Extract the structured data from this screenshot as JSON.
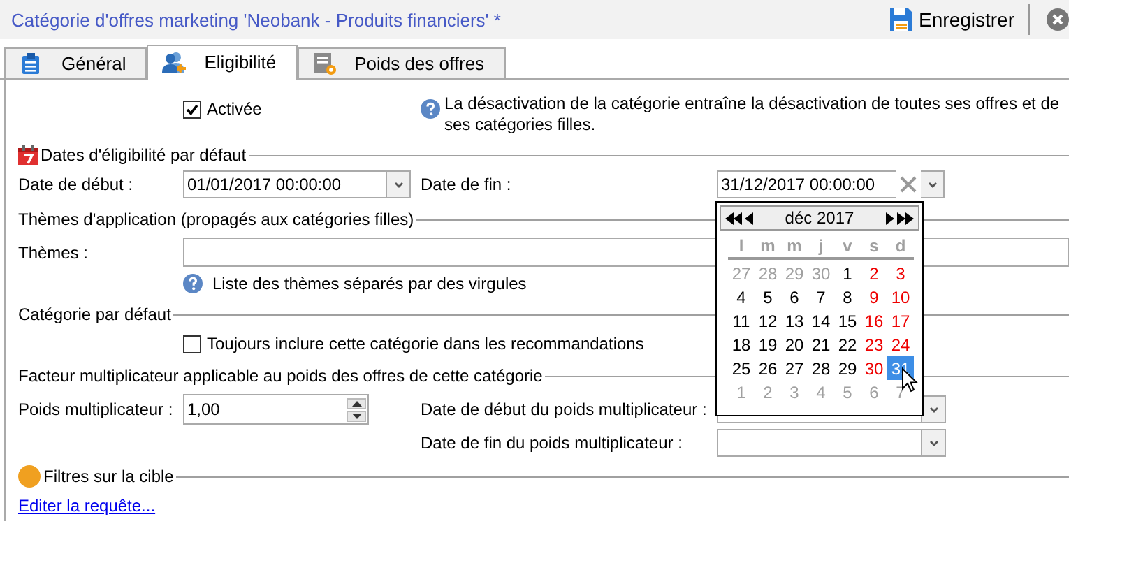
{
  "window": {
    "title": "Catégorie d'offres marketing 'Neobank - Produits financiers' *"
  },
  "toolbar": {
    "save_label": "Enregistrer"
  },
  "tabs": [
    {
      "label": "Général",
      "selected": false
    },
    {
      "label": "Eligibilité",
      "selected": true
    },
    {
      "label": "Poids des offres",
      "selected": false
    }
  ],
  "activation": {
    "label": "Activée",
    "checked": true,
    "help": "La désactivation de la catégorie entraîne la désactivation de toutes ses offres et de ses catégories filles."
  },
  "eligibility_dates": {
    "heading": "Dates d'éligibilité par défaut",
    "start": {
      "label": "Date de début :",
      "value": "01/01/2017 00:00:00"
    },
    "end": {
      "label": "Date de fin :",
      "value": "31/12/2017 00:00:00"
    }
  },
  "calendar": {
    "month": "déc 2017",
    "weekdays": [
      "l",
      "m",
      "m",
      "j",
      "v",
      "s",
      "d"
    ],
    "weeks": [
      [
        {
          "day": "27",
          "kind": "other",
          "selected": false
        },
        {
          "day": "28",
          "kind": "other",
          "selected": false
        },
        {
          "day": "29",
          "kind": "other",
          "selected": false
        },
        {
          "day": "30",
          "kind": "other",
          "selected": false
        },
        {
          "day": "1",
          "kind": "weekday",
          "selected": false
        },
        {
          "day": "2",
          "kind": "weekend",
          "selected": false
        },
        {
          "day": "3",
          "kind": "weekend",
          "selected": false
        }
      ],
      [
        {
          "day": "4",
          "kind": "weekday",
          "selected": false
        },
        {
          "day": "5",
          "kind": "weekday",
          "selected": false
        },
        {
          "day": "6",
          "kind": "weekday",
          "selected": false
        },
        {
          "day": "7",
          "kind": "weekday",
          "selected": false
        },
        {
          "day": "8",
          "kind": "weekday",
          "selected": false
        },
        {
          "day": "9",
          "kind": "weekend",
          "selected": false
        },
        {
          "day": "10",
          "kind": "weekend",
          "selected": false
        }
      ],
      [
        {
          "day": "11",
          "kind": "weekday",
          "selected": false
        },
        {
          "day": "12",
          "kind": "weekday",
          "selected": false
        },
        {
          "day": "13",
          "kind": "weekday",
          "selected": false
        },
        {
          "day": "14",
          "kind": "weekday",
          "selected": false
        },
        {
          "day": "15",
          "kind": "weekday",
          "selected": false
        },
        {
          "day": "16",
          "kind": "weekend",
          "selected": false
        },
        {
          "day": "17",
          "kind": "weekend",
          "selected": false
        }
      ],
      [
        {
          "day": "18",
          "kind": "weekday",
          "selected": false
        },
        {
          "day": "19",
          "kind": "weekday",
          "selected": false
        },
        {
          "day": "20",
          "kind": "weekday",
          "selected": false
        },
        {
          "day": "21",
          "kind": "weekday",
          "selected": false
        },
        {
          "day": "22",
          "kind": "weekday",
          "selected": false
        },
        {
          "day": "23",
          "kind": "weekend",
          "selected": false
        },
        {
          "day": "24",
          "kind": "weekend",
          "selected": false
        }
      ],
      [
        {
          "day": "25",
          "kind": "weekday",
          "selected": false
        },
        {
          "day": "26",
          "kind": "weekday",
          "selected": false
        },
        {
          "day": "27",
          "kind": "weekday",
          "selected": false
        },
        {
          "day": "28",
          "kind": "weekday",
          "selected": false
        },
        {
          "day": "29",
          "kind": "weekday",
          "selected": false
        },
        {
          "day": "30",
          "kind": "weekend",
          "selected": false
        },
        {
          "day": "31",
          "kind": "weekend",
          "selected": true
        }
      ],
      [
        {
          "day": "1",
          "kind": "other",
          "selected": false
        },
        {
          "day": "2",
          "kind": "other",
          "selected": false
        },
        {
          "day": "3",
          "kind": "other",
          "selected": false
        },
        {
          "day": "4",
          "kind": "other",
          "selected": false
        },
        {
          "day": "5",
          "kind": "other",
          "selected": false
        },
        {
          "day": "6",
          "kind": "other",
          "selected": false
        },
        {
          "day": "7",
          "kind": "other",
          "selected": false
        }
      ]
    ]
  },
  "themes": {
    "heading": "Thèmes d'application (propagés aux catégories filles)",
    "label": "Thèmes :",
    "help": "Liste des thèmes séparés par des virgules"
  },
  "default_category": {
    "heading": "Catégorie par défaut",
    "option": {
      "label": "Toujours inclure cette catégorie dans les recommandations",
      "checked": false
    }
  },
  "multiplier": {
    "heading": "Facteur multiplicateur applicable au poids des offres de cette catégorie",
    "weight": {
      "label": "Poids multiplicateur :",
      "value": "1,00"
    },
    "start_label": "Date de début du poids multiplicateur :",
    "end_label": "Date de fin du poids multiplicateur :"
  },
  "target_filters": {
    "heading": "Filtres sur la cible",
    "link": "Editer la requête..."
  }
}
